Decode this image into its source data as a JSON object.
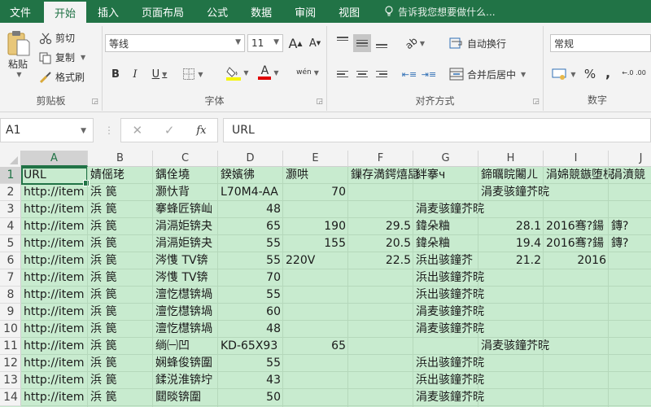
{
  "ribbon_tabs": [
    {
      "label": "文件"
    },
    {
      "label": "开始",
      "active": true
    },
    {
      "label": "插入"
    },
    {
      "label": "页面布局"
    },
    {
      "label": "公式"
    },
    {
      "label": "数据"
    },
    {
      "label": "审阅"
    },
    {
      "label": "视图"
    }
  ],
  "tell_me": "告诉我您想要做什么...",
  "clipboard": {
    "paste": "粘贴",
    "cut": "剪切",
    "copy": "复制",
    "format_painter": "格式刷",
    "group_label": "剪贴板"
  },
  "font": {
    "name": "等线",
    "size": "11",
    "bold": "B",
    "italic": "I",
    "underline": "U",
    "grow": "A",
    "shrink": "A",
    "font_color": "A",
    "phonetic": "wén",
    "group_label": "字体"
  },
  "alignment": {
    "wrap_text": "自动换行",
    "merge_center": "合并后居中",
    "group_label": "对齐方式"
  },
  "number": {
    "format": "常规",
    "percent": "%",
    "comma": ",",
    "decimal": "←.0 .00",
    "group_label": "数字"
  },
  "formula_bar": {
    "name_box": "A1",
    "cancel": "✕",
    "enter": "✓",
    "fx": "fx",
    "content": "URL"
  },
  "colors": {
    "accent": "#217346",
    "cell_fill": "#c8ebcf"
  },
  "columns": [
    "A",
    "B",
    "C",
    "D",
    "E",
    "F",
    "G",
    "H",
    "I",
    "J"
  ],
  "selected_cell": "A1",
  "rows": [
    {
      "n": "1",
      "cells": {
        "A": "URL",
        "B": "婧傜珯",
        "C": "鍝佺墝",
        "D": "鍨嬪彿",
        "E": "灏哄",
        "F": "鏁存満鍔熺巼",
        "G": "   絆搴ч",
        "H": "鍗曞睆闂ㄦ",
        "I": "涓婂競鏃堕棿",
        "J": "涓濆競"
      }
    },
    {
      "n": "2",
      "cells": {
        "A": "http://item",
        "B": "浜   笢",
        "C": "灏忕背",
        "D": "L70M4-AA",
        "E": "70",
        "H": "涓麦骇鐘芥晥"
      }
    },
    {
      "n": "3",
      "cells": {
        "A": "http://item",
        "B": "浜   笢",
        "C": "搴蜂匠锛屾",
        "D": "48",
        "G": "涓麦骇鐘芥晥"
      }
    },
    {
      "n": "4",
      "cells": {
        "A": "http://item",
        "B": "浜   笢",
        "C": "涓滆姖锛夬",
        "D": "65",
        "E": "190",
        "F": "29.5",
        "G": "鍏朵粬",
        "H": "28.1",
        "I": "2016骞?鍚",
        "J": "鏄?"
      }
    },
    {
      "n": "5",
      "cells": {
        "A": "http://item",
        "B": "浜   笢",
        "C": "涓滆姖锛夬",
        "D": "55",
        "E": "155",
        "F": "20.5",
        "G": "鍏朵粬",
        "H": "19.4",
        "I": "2016骞?鍚",
        "J": "鏄?"
      }
    },
    {
      "n": "6",
      "cells": {
        "A": "http://item",
        "B": "浜   笢",
        "C": "涔愯   TV锛",
        "D": "55",
        "E": "220V",
        "F": "22.5",
        "G": "浜出骇鐘芥",
        "H": "21.2",
        "I": "2016"
      }
    },
    {
      "n": "7",
      "cells": {
        "A": "http://item",
        "B": "浜   笢",
        "C": "涔愯   TV锛",
        "D": "70",
        "G": "浜出骇鐘芥晥"
      }
    },
    {
      "n": "8",
      "cells": {
        "A": "http://item",
        "B": "浜   笢",
        "C": "澶忔櫘锛堝",
        "D": "55",
        "G": "浜出骇鐘芥晥"
      }
    },
    {
      "n": "9",
      "cells": {
        "A": "http://item",
        "B": "浜   笢",
        "C": "澶忔櫘锛堝",
        "D": "60",
        "G": "涓麦骇鐘芥晥"
      }
    },
    {
      "n": "10",
      "cells": {
        "A": "http://item",
        "B": "浜   笢",
        "C": "澶忔櫘锛堝",
        "D": "48",
        "G": "涓麦骇鐘芥晥"
      }
    },
    {
      "n": "11",
      "cells": {
        "A": "http://item",
        "B": "浜   笢",
        "C": "绱㈠凹",
        "D": "KD-65X93",
        "E": "65",
        "H": "涓麦骇鐘芥晥"
      }
    },
    {
      "n": "12",
      "cells": {
        "A": "http://item",
        "B": "浜   笢",
        "C": "娴蜂俊锛圍",
        "D": "55",
        "G": "浜出骇鐘芥晥"
      }
    },
    {
      "n": "13",
      "cells": {
        "A": "http://item",
        "B": "浜   笢",
        "C": "鍒涚淮锛坾",
        "D": "43",
        "G": "浜出骇鐘芥晥"
      }
    },
    {
      "n": "14",
      "cells": {
        "A": "http://item",
        "B": "浜   笢",
        "C": "閮晱锛圍",
        "D": "50",
        "G": "涓麦骇鐘芥晥"
      }
    }
  ]
}
